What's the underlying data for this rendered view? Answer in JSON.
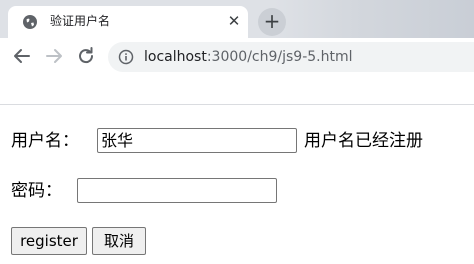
{
  "browser": {
    "tab_title": "验证用户名",
    "close_glyph": "✕",
    "new_tab_glyph": "+",
    "url_host": "localhost",
    "url_path": ":3000/ch9/js9-5.html"
  },
  "form": {
    "username_label": "用户名：",
    "username_value": "张华",
    "username_status": "用户名已经注册",
    "password_label": "密码：",
    "password_value": "",
    "register_label": "register",
    "cancel_label": "取消"
  },
  "colors": {
    "tabstrip": "#dee1e6",
    "omnibox": "#f1f3f4",
    "button_bg": "#efefef",
    "border": "#767676"
  }
}
